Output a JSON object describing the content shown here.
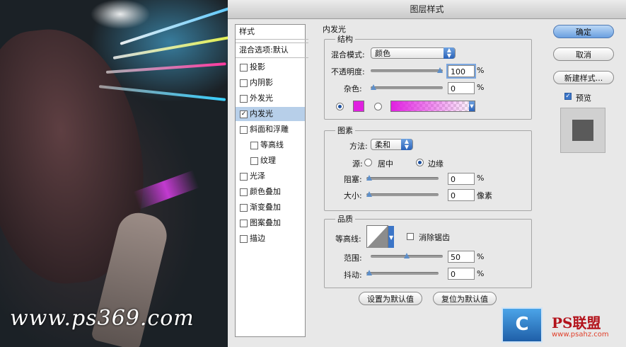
{
  "watermark": "www.ps369.com",
  "dialog": {
    "title": "图层样式",
    "styles_header": "样式",
    "blend_options": "混合选项:默认",
    "style_items": [
      {
        "label": "投影",
        "checked": false,
        "indent": false,
        "selected": false
      },
      {
        "label": "内阴影",
        "checked": false,
        "indent": false,
        "selected": false
      },
      {
        "label": "外发光",
        "checked": false,
        "indent": false,
        "selected": false
      },
      {
        "label": "内发光",
        "checked": true,
        "indent": false,
        "selected": true
      },
      {
        "label": "斜面和浮雕",
        "checked": false,
        "indent": false,
        "selected": false
      },
      {
        "label": "等高线",
        "checked": false,
        "indent": true,
        "selected": false
      },
      {
        "label": "纹理",
        "checked": false,
        "indent": true,
        "selected": false
      },
      {
        "label": "光泽",
        "checked": false,
        "indent": false,
        "selected": false
      },
      {
        "label": "颜色叠加",
        "checked": false,
        "indent": false,
        "selected": false
      },
      {
        "label": "渐变叠加",
        "checked": false,
        "indent": false,
        "selected": false
      },
      {
        "label": "图案叠加",
        "checked": false,
        "indent": false,
        "selected": false
      },
      {
        "label": "描边",
        "checked": false,
        "indent": false,
        "selected": false
      }
    ],
    "panel_title": "内发光",
    "structure": {
      "legend": "结构",
      "blend_mode_label": "混合模式:",
      "blend_mode_value": "颜色",
      "opacity_label": "不透明度:",
      "opacity_value": "100",
      "opacity_level": 100,
      "noise_label": "杂色:",
      "noise_value": "0",
      "noise_level": 0,
      "percent": "%",
      "glow_color": "#e020e0"
    },
    "elements": {
      "legend": "图素",
      "technique_label": "方法:",
      "technique_value": "柔和",
      "source_label": "源:",
      "source_center": "居中",
      "source_edge": "边缘",
      "choke_label": "阻塞:",
      "choke_value": "0",
      "choke_level": 0,
      "size_label": "大小:",
      "size_value": "0",
      "size_level": 0,
      "percent": "%",
      "px_unit": "像素"
    },
    "quality": {
      "legend": "品质",
      "contour_label": "等高线:",
      "antialias_label": "消除锯齿",
      "range_label": "范围:",
      "range_value": "50",
      "range_level": 50,
      "jitter_label": "抖动:",
      "jitter_value": "0",
      "jitter_level": 0,
      "percent": "%"
    },
    "make_default": "设置为默认值",
    "reset_default": "复位为默认值",
    "ok": "确定",
    "cancel": "取消",
    "new_style": "新建样式...",
    "preview_label": "预览",
    "check_mark": "✓"
  },
  "logos": {
    "mark": "C",
    "brand_text": "PS联盟",
    "brand_url": "www.psahz.com"
  }
}
